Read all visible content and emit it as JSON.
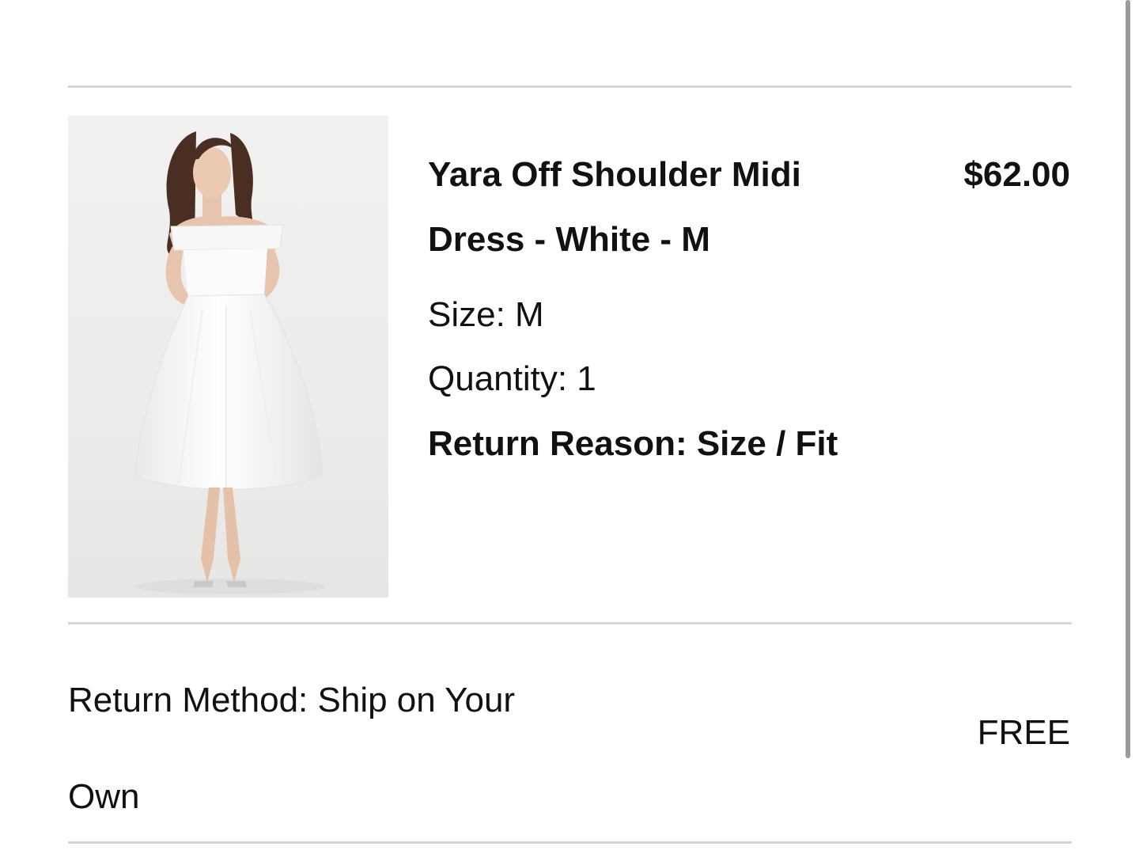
{
  "item": {
    "title": "Yara Off Shoulder Midi Dress - White - M",
    "price": "$62.00",
    "size": "Size: M",
    "quantity": "Quantity: 1",
    "return_reason": "Return Reason: Size / Fit",
    "image_alt": "White off-shoulder midi dress product photo"
  },
  "return_method": {
    "label": "Return Method: Ship on Your Own",
    "cost": "FREE"
  }
}
